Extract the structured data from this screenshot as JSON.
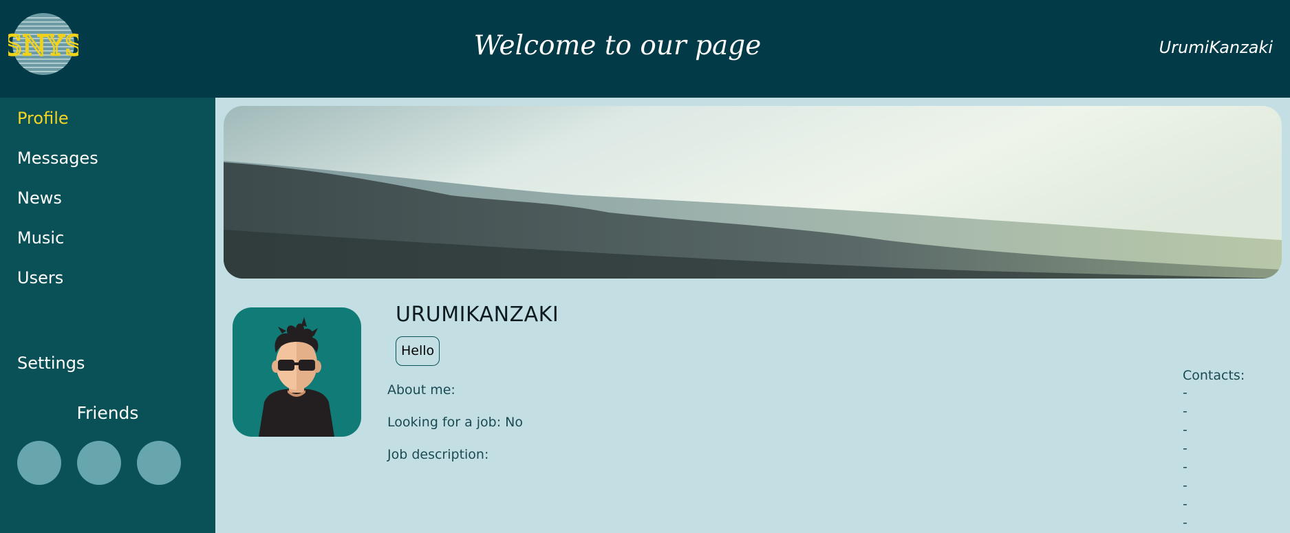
{
  "header": {
    "logo_text": "SNYS",
    "title": "Welcome to our page",
    "user": "UrumiKanzaki"
  },
  "sidebar": {
    "items": [
      {
        "label": "Profile",
        "active": true
      },
      {
        "label": "Messages"
      },
      {
        "label": "News"
      },
      {
        "label": "Music"
      },
      {
        "label": "Users"
      }
    ],
    "settings_label": "Settings",
    "friends_title": "Friends",
    "friend_count": 3
  },
  "profile": {
    "name": "URUMIKANZAKI",
    "status": "Hello",
    "about_me": "About me:",
    "looking_for_job": "Looking for a job: No",
    "job_description": "Job description:"
  },
  "contacts": {
    "title": "Contacts:",
    "entries": [
      "-",
      "-",
      "-",
      "-",
      "-",
      "-",
      "-",
      "-"
    ]
  },
  "colors": {
    "header_bg": "#023b47",
    "sidebar_bg": "#0a5157",
    "content_bg": "#c3dfe4",
    "active_nav": "#f3d424",
    "friend_avatar": "#68a6ad",
    "avatar_bg": "#117b78"
  }
}
